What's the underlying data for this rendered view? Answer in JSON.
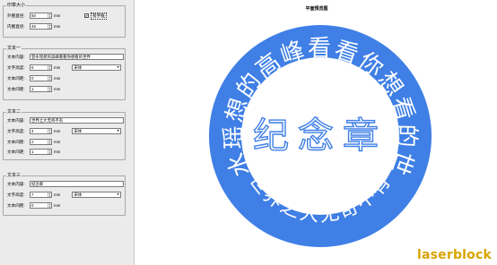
{
  "ring_group": {
    "title": "印章大小",
    "outer_label": "外圈直径:",
    "outer_value": "60",
    "inner_label": "内圈直径:",
    "inner_value": "45",
    "unit": "mm",
    "checkbox_label": "有字框",
    "checkbox_checked": true
  },
  "text1": {
    "title": "文本一",
    "content_label": "文本内容:",
    "content_value": "登水瑶想的高峰看看你想看的世界",
    "height_label": "文字高度:",
    "height_value": "6",
    "font_value": "宋体",
    "space_label": "文本间距:",
    "space_value": "0",
    "gap_label": "文本间距:",
    "gap_value": "1",
    "unit": "mm"
  },
  "text2": {
    "title": "文本二",
    "content_label": "文本内容:",
    "content_value": "世界之大无奇不有",
    "height_label": "文字高度:",
    "height_value": "4",
    "font_value": "宋体",
    "space_label": "文本间距:",
    "space_value": "2",
    "gap_label": "文本间距:",
    "gap_value": "1",
    "unit": "mm"
  },
  "text3": {
    "title": "文本三",
    "content_label": "文本内容:",
    "content_value": "纪念章",
    "height_label": "文字高度:",
    "height_value": "7",
    "font_value": "宋体",
    "space_label": "文本间距:",
    "space_value": "0",
    "unit": "mm"
  },
  "preview": {
    "title": "平面预览图",
    "ring_color": "#3f7fe6",
    "text_color": "#3f7fe6",
    "outer_text": "登水瑶想的高峰看看你想看的世界",
    "bottom_text": "世界之大无奇不有",
    "center_text": "纪念章"
  },
  "watermark": "laserblock"
}
